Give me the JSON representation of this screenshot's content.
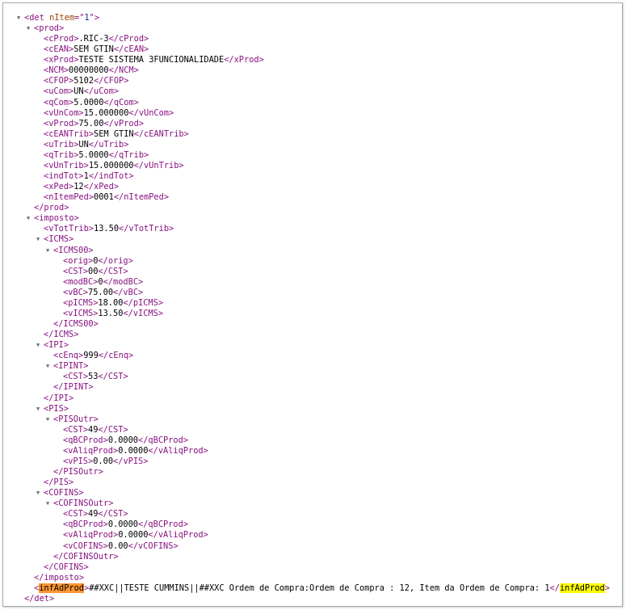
{
  "colors": {
    "tag": "#881280",
    "current_match": "#ff9632",
    "match": "#ffff00"
  },
  "search_term": "infAdProd",
  "lines": [
    {
      "d": 0,
      "k": "open",
      "toggle": true,
      "tag": "det",
      "attr": "nItem",
      "aval": "1"
    },
    {
      "d": 1,
      "k": "open",
      "toggle": true,
      "tag": "prod"
    },
    {
      "d": 2,
      "k": "leaf",
      "tag": "cProd",
      "text": ".RIC-3"
    },
    {
      "d": 2,
      "k": "leaf",
      "tag": "cEAN",
      "text": "SEM GTIN"
    },
    {
      "d": 2,
      "k": "leaf",
      "tag": "xProd",
      "text": "TESTE SISTEMA 3FUNCIONALIDADE"
    },
    {
      "d": 2,
      "k": "leaf",
      "tag": "NCM",
      "text": "00000000"
    },
    {
      "d": 2,
      "k": "leaf",
      "tag": "CFOP",
      "text": "5102"
    },
    {
      "d": 2,
      "k": "leaf",
      "tag": "uCom",
      "text": "UN"
    },
    {
      "d": 2,
      "k": "leaf",
      "tag": "qCom",
      "text": "5.0000"
    },
    {
      "d": 2,
      "k": "leaf",
      "tag": "vUnCom",
      "text": "15.000000"
    },
    {
      "d": 2,
      "k": "leaf",
      "tag": "vProd",
      "text": "75.00"
    },
    {
      "d": 2,
      "k": "leaf",
      "tag": "cEANTrib",
      "text": "SEM GTIN"
    },
    {
      "d": 2,
      "k": "leaf",
      "tag": "uTrib",
      "text": "UN"
    },
    {
      "d": 2,
      "k": "leaf",
      "tag": "qTrib",
      "text": "5.0000"
    },
    {
      "d": 2,
      "k": "leaf",
      "tag": "vUnTrib",
      "text": "15.000000"
    },
    {
      "d": 2,
      "k": "leaf",
      "tag": "indTot",
      "text": "1"
    },
    {
      "d": 2,
      "k": "leaf",
      "tag": "xPed",
      "text": "12"
    },
    {
      "d": 2,
      "k": "leaf",
      "tag": "nItemPed",
      "text": "0001"
    },
    {
      "d": 1,
      "k": "close",
      "tag": "prod"
    },
    {
      "d": 1,
      "k": "open",
      "toggle": true,
      "tag": "imposto"
    },
    {
      "d": 2,
      "k": "leaf",
      "tag": "vTotTrib",
      "text": "13.50"
    },
    {
      "d": 2,
      "k": "open",
      "toggle": true,
      "tag": "ICMS"
    },
    {
      "d": 3,
      "k": "open",
      "toggle": true,
      "tag": "ICMS00"
    },
    {
      "d": 4,
      "k": "leaf",
      "tag": "orig",
      "text": "0"
    },
    {
      "d": 4,
      "k": "leaf",
      "tag": "CST",
      "text": "00"
    },
    {
      "d": 4,
      "k": "leaf",
      "tag": "modBC",
      "text": "0"
    },
    {
      "d": 4,
      "k": "leaf",
      "tag": "vBC",
      "text": "75.00"
    },
    {
      "d": 4,
      "k": "leaf",
      "tag": "pICMS",
      "text": "18.00"
    },
    {
      "d": 4,
      "k": "leaf",
      "tag": "vICMS",
      "text": "13.50"
    },
    {
      "d": 3,
      "k": "close",
      "tag": "ICMS00"
    },
    {
      "d": 2,
      "k": "close",
      "tag": "ICMS"
    },
    {
      "d": 2,
      "k": "open",
      "toggle": true,
      "tag": "IPI"
    },
    {
      "d": 3,
      "k": "leaf",
      "tag": "cEnq",
      "text": "999"
    },
    {
      "d": 3,
      "k": "open",
      "toggle": true,
      "tag": "IPINT"
    },
    {
      "d": 4,
      "k": "leaf",
      "tag": "CST",
      "text": "53"
    },
    {
      "d": 3,
      "k": "close",
      "tag": "IPINT"
    },
    {
      "d": 2,
      "k": "close",
      "tag": "IPI"
    },
    {
      "d": 2,
      "k": "open",
      "toggle": true,
      "tag": "PIS"
    },
    {
      "d": 3,
      "k": "open",
      "toggle": true,
      "tag": "PISOutr"
    },
    {
      "d": 4,
      "k": "leaf",
      "tag": "CST",
      "text": "49"
    },
    {
      "d": 4,
      "k": "leaf",
      "tag": "qBCProd",
      "text": "0.0000"
    },
    {
      "d": 4,
      "k": "leaf",
      "tag": "vAliqProd",
      "text": "0.0000"
    },
    {
      "d": 4,
      "k": "leaf",
      "tag": "vPIS",
      "text": "0.00"
    },
    {
      "d": 3,
      "k": "close",
      "tag": "PISOutr"
    },
    {
      "d": 2,
      "k": "close",
      "tag": "PIS"
    },
    {
      "d": 2,
      "k": "open",
      "toggle": true,
      "tag": "COFINS"
    },
    {
      "d": 3,
      "k": "open",
      "toggle": true,
      "tag": "COFINSOutr"
    },
    {
      "d": 4,
      "k": "leaf",
      "tag": "CST",
      "text": "49"
    },
    {
      "d": 4,
      "k": "leaf",
      "tag": "qBCProd",
      "text": "0.0000"
    },
    {
      "d": 4,
      "k": "leaf",
      "tag": "vAliqProd",
      "text": "0.0000"
    },
    {
      "d": 4,
      "k": "leaf",
      "tag": "vCOFINS",
      "text": "0.00"
    },
    {
      "d": 3,
      "k": "close",
      "tag": "COFINSOutr"
    },
    {
      "d": 2,
      "k": "close",
      "tag": "COFINS"
    },
    {
      "d": 1,
      "k": "close",
      "tag": "imposto"
    },
    {
      "d": 1,
      "k": "leaf",
      "tag": "infAdProd",
      "text": "##XXC||TESTE CUMMINS||##XXC Ordem de Compra:Ordem de Compra : 12, Item da Ordem de Compra: 1",
      "hl_open": "current",
      "hl_close": "match"
    },
    {
      "d": 0,
      "k": "close",
      "tag": "det"
    }
  ]
}
